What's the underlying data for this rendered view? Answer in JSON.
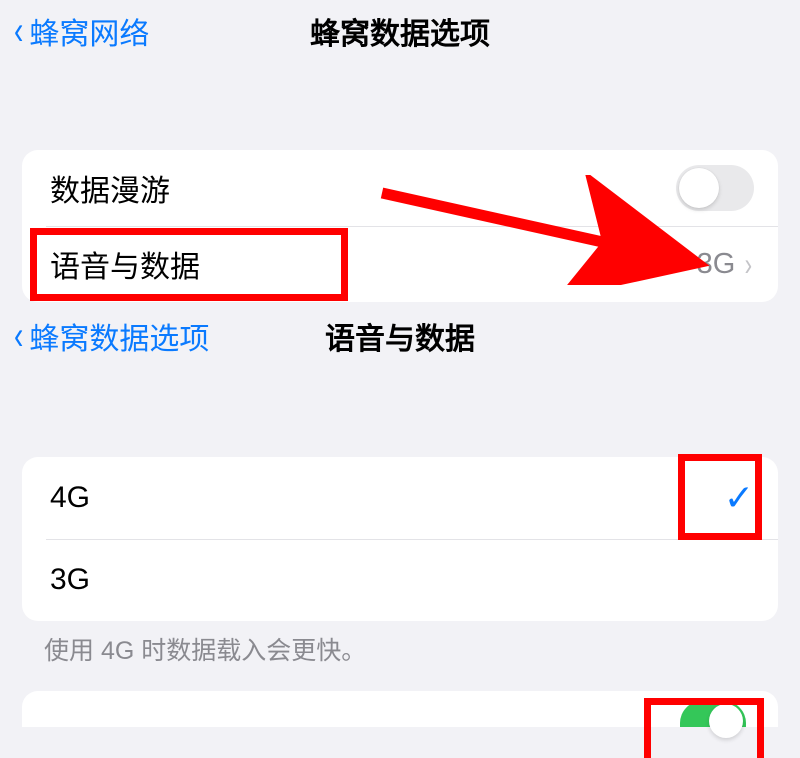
{
  "screen1": {
    "back_label": "蜂窝网络",
    "title": "蜂窝数据选项",
    "rows": {
      "roaming_label": "数据漫游",
      "voice_data_label": "语音与数据",
      "voice_data_value": "3G"
    }
  },
  "screen2": {
    "back_label": "蜂窝数据选项",
    "title": "语音与数据",
    "options": {
      "opt0": "4G",
      "opt1": "3G"
    },
    "footer": "使用 4G 时数据载入会更快。",
    "selected_index": 0
  }
}
